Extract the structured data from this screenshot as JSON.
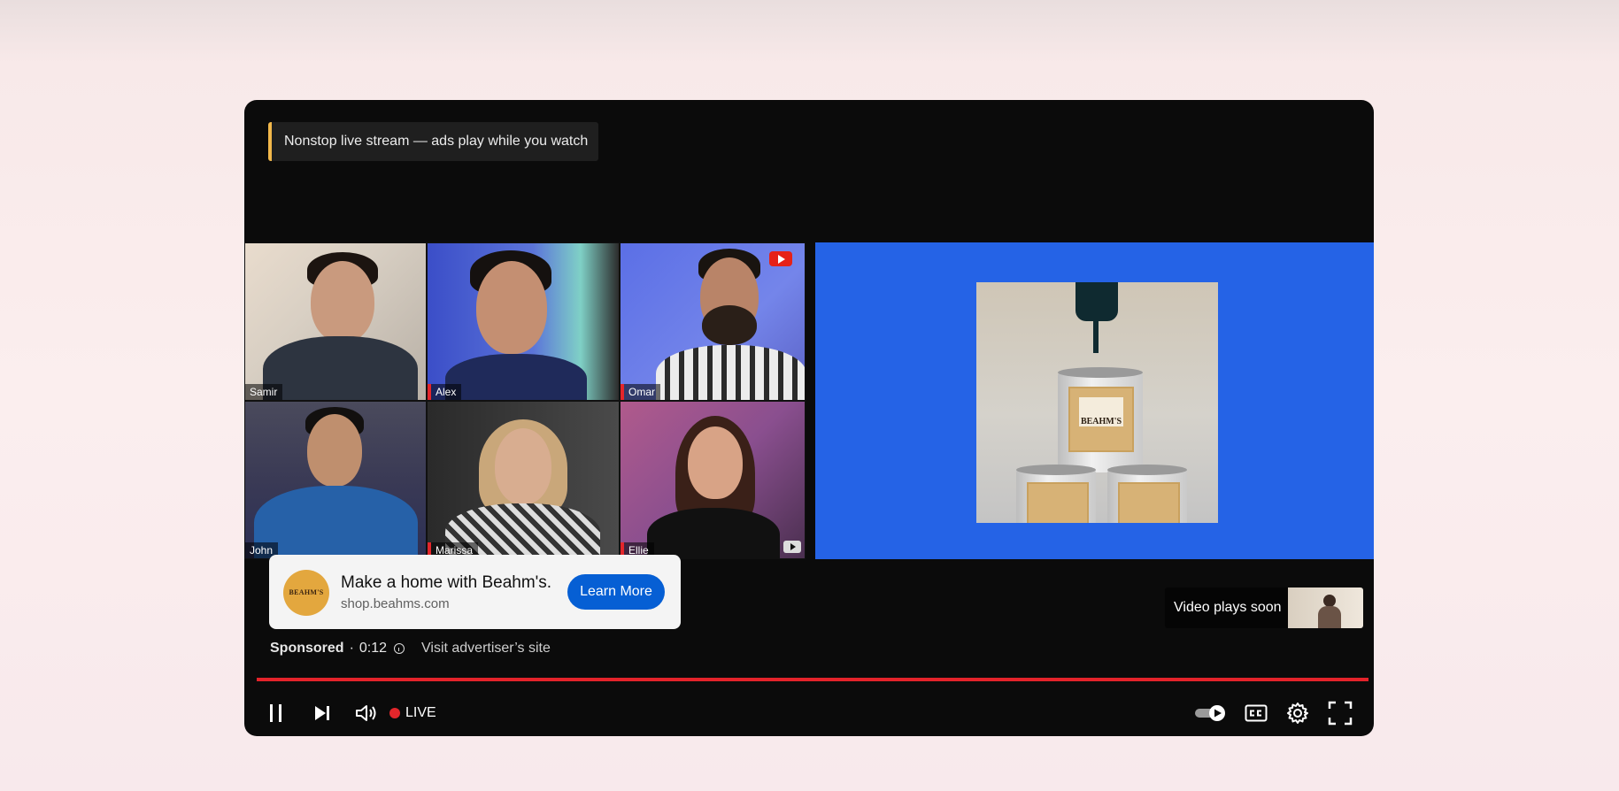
{
  "notice": {
    "text": "Nonstop live stream — ads play while you watch"
  },
  "participants": [
    {
      "name": "Samir"
    },
    {
      "name": "Alex"
    },
    {
      "name": "Omar"
    },
    {
      "name": "John"
    },
    {
      "name": "Marissa"
    },
    {
      "name": "Ellie"
    }
  ],
  "product": {
    "brand": "BEAHM'S"
  },
  "ad": {
    "logo_text": "BEAHM'S",
    "title": "Make a home with Beahm's.",
    "url": "shop.beahms.com",
    "cta_label": "Learn More",
    "sponsored_label": "Sponsored",
    "separator": "·",
    "countdown": "0:12",
    "visit_label": "Visit advertiser’s site"
  },
  "up_next": {
    "label": "Video plays soon"
  },
  "player": {
    "live_label": "LIVE",
    "accent_color": "#e4232a",
    "cta_color": "#065fd4",
    "panel_color": "#2563e6"
  },
  "icons": [
    "pause-icon",
    "next-icon",
    "volume-icon",
    "autoplay-toggle",
    "captions-icon",
    "settings-gear-icon",
    "fullscreen-icon",
    "info-icon",
    "youtube-icon"
  ]
}
